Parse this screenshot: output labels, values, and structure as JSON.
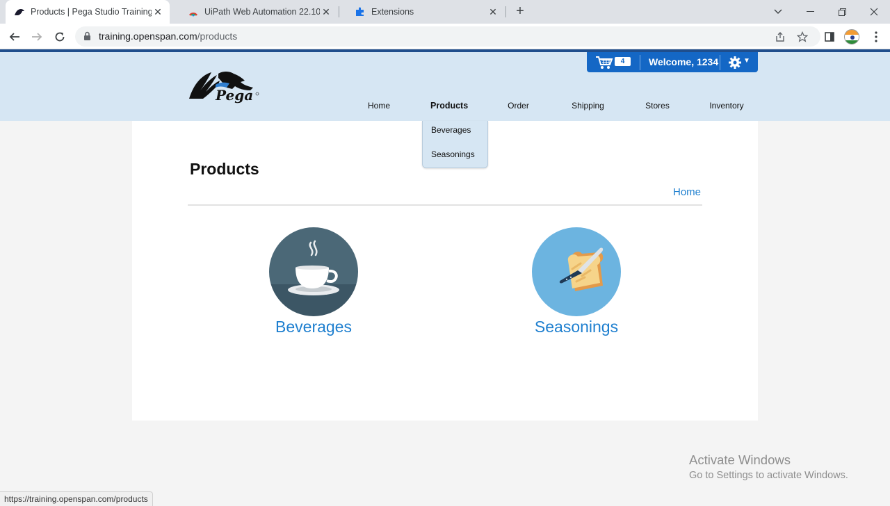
{
  "browser": {
    "tabs": [
      {
        "title": "Products | Pega Studio Training W",
        "favicon": "pega-icon"
      },
      {
        "title": "UiPath Web Automation 22.10 - C",
        "favicon": "uipath-icon"
      },
      {
        "title": "Extensions",
        "favicon": "puzzle-icon"
      }
    ],
    "url_host": "training.openspan.com",
    "url_path": "/products",
    "status_url": "https://training.openspan.com/products"
  },
  "header": {
    "cart_count": "4",
    "welcome": "Welcome, 1234",
    "nav": [
      {
        "label": "Home"
      },
      {
        "label": "Products"
      },
      {
        "label": "Order"
      },
      {
        "label": "Shipping"
      },
      {
        "label": "Stores"
      },
      {
        "label": "Inventory"
      }
    ],
    "dropdown": [
      "Beverages",
      "Seasonings"
    ]
  },
  "main": {
    "title": "Products",
    "breadcrumb": "Home",
    "categories": [
      {
        "label": "Beverages",
        "icon": "coffee-cup-icon"
      },
      {
        "label": "Seasonings",
        "icon": "bread-knife-icon"
      }
    ]
  },
  "watermark": {
    "line1": "Activate Windows",
    "line2": "Go to Settings to activate Windows."
  },
  "colors": {
    "header_bg": "#d6e6f3",
    "accent_blue": "#1467c5",
    "link_blue": "#1e7fcf"
  }
}
